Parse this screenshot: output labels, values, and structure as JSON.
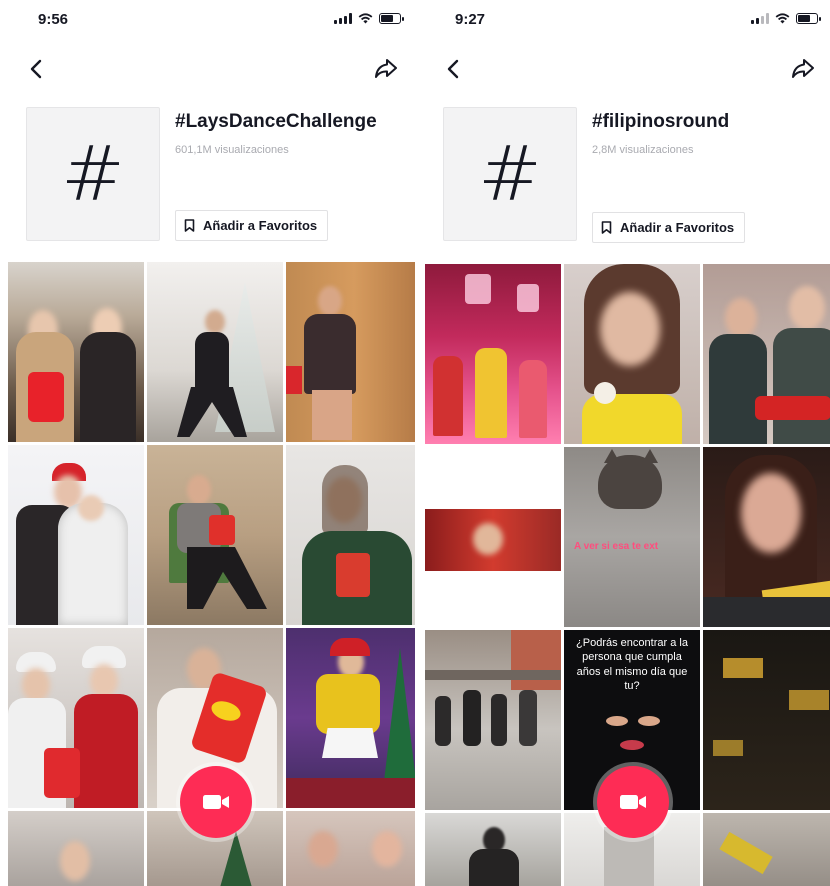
{
  "left": {
    "status": {
      "time": "9:56"
    },
    "hashtag": {
      "symbol": "#",
      "title": "#LaysDanceChallenge",
      "views": "601,1M visualizaciones",
      "fav_label": "Añadir a Favoritos"
    }
  },
  "right": {
    "status": {
      "time": "9:27"
    },
    "hashtag": {
      "symbol": "#",
      "title": "#filipinosround",
      "views": "2,8M visualizaciones",
      "fav_label": "Añadir a Favoritos"
    },
    "video_caption": "¿Podrás encontrar a la persona que cumpla años el mismo día que tu?",
    "video_overlay_text": "A ver si esa te ext"
  },
  "colors": {
    "accent": "#fe2c55",
    "text": "#161823",
    "muted": "#a9aab0"
  },
  "icons": [
    "back-arrow-icon",
    "share-arrow-icon",
    "bookmark-icon",
    "video-camera-icon",
    "signal-icon",
    "wifi-icon",
    "battery-icon"
  ]
}
